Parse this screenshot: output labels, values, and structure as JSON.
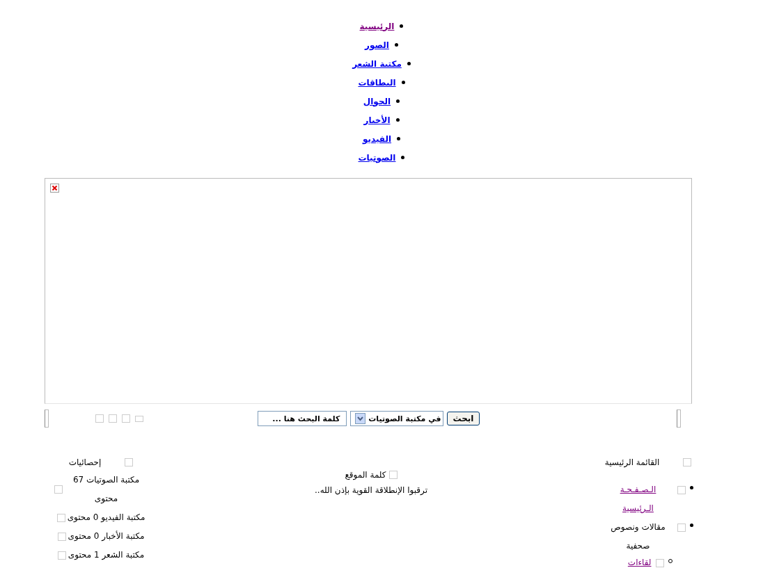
{
  "nav": [
    {
      "label": "الرئيسية",
      "visited": true
    },
    {
      "label": "الصور",
      "visited": false
    },
    {
      "label": "مكتبة الشعر",
      "visited": false
    },
    {
      "label": "البطاقات",
      "visited": false
    },
    {
      "label": "الجوال",
      "visited": false
    },
    {
      "label": "الأخبار",
      "visited": false
    },
    {
      "label": "الفيديو",
      "visited": false
    },
    {
      "label": "الصوتيات",
      "visited": false
    }
  ],
  "search": {
    "value": "كلمة البحث هنا ...",
    "scope": "في مكتبة الصوتيات",
    "button": "ابحث"
  },
  "main_menu": {
    "title": "القائمة الرئيسية",
    "items": [
      {
        "label": "الـصـفـحـة الـرئيسية",
        "kind": "link"
      },
      {
        "label": "مقالات ونصوص صحفية",
        "kind": "text",
        "children": [
          {
            "label": "لقاءات",
            "kind": "link"
          }
        ]
      }
    ]
  },
  "site_word": {
    "title": "كلمة الموقع",
    "text": "ترقبوا الإنطلاقة القوية بإذن الله.."
  },
  "stats": {
    "title": "إحصائيات",
    "items": [
      "مكتبة الصوتيات 67 محتوى",
      "مكتبة الفيديو 0 محتوى",
      "مكتبة الأخبار 0 محتوى",
      "مكتبة الشعر 1 محتوى"
    ]
  }
}
